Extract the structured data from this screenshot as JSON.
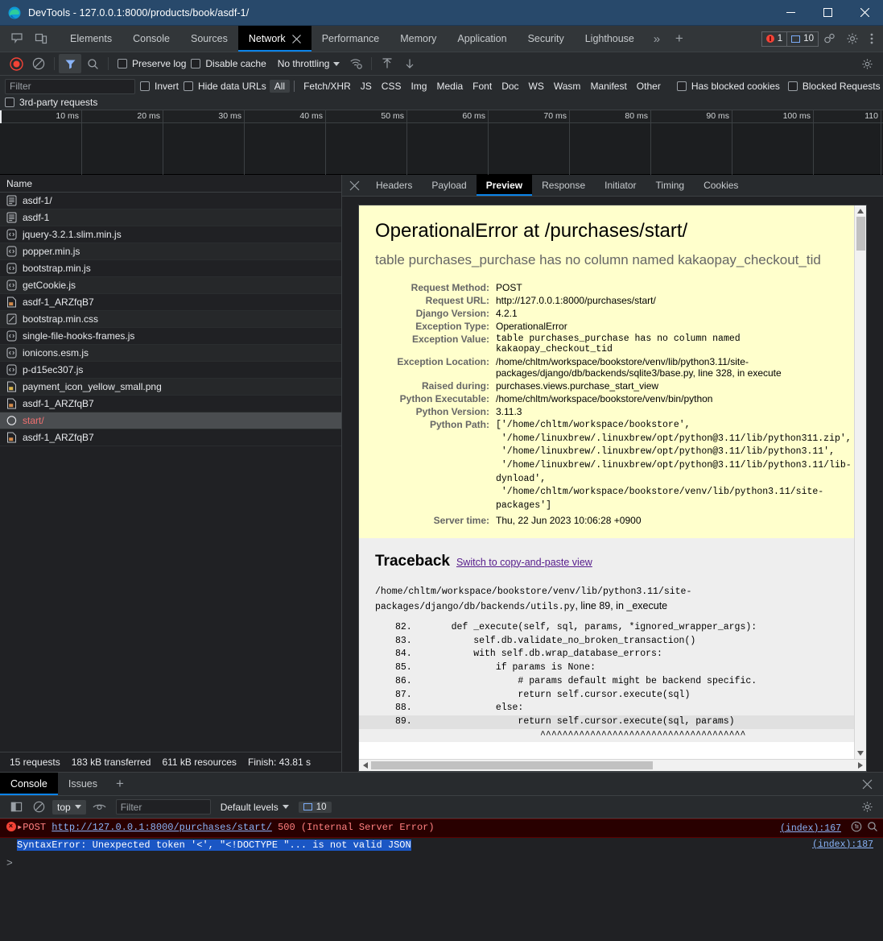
{
  "window": {
    "title": "DevTools - 127.0.0.1:8000/products/book/asdf-1/",
    "minimize": "minimize-icon",
    "maximize": "maximize-icon",
    "close": "close-icon"
  },
  "main_tabs": {
    "items": [
      {
        "label": "Elements",
        "active": false
      },
      {
        "label": "Console",
        "active": false
      },
      {
        "label": "Sources",
        "active": false
      },
      {
        "label": "Network",
        "active": true,
        "closable": true
      },
      {
        "label": "Performance",
        "active": false
      },
      {
        "label": "Memory",
        "active": false
      },
      {
        "label": "Application",
        "active": false
      },
      {
        "label": "Security",
        "active": false
      },
      {
        "label": "Lighthouse",
        "active": false
      }
    ],
    "more": "»",
    "add": "+",
    "error_count": "1",
    "message_count": "10"
  },
  "network_toolbar": {
    "record_label": "record-button",
    "clear_label": "clear-button",
    "filter_label": "filter-button",
    "search_label": "search-button",
    "preserve_log": "Preserve log",
    "disable_cache": "Disable cache",
    "throttling": "No throttling",
    "import_label": "import-har-button",
    "export_label": "export-har-button",
    "settings_label": "settings-gear"
  },
  "filter_bar": {
    "placeholder": "Filter",
    "value": "",
    "invert": "Invert",
    "hide_data_urls": "Hide data URLs",
    "types": [
      "All",
      "Fetch/XHR",
      "JS",
      "CSS",
      "Img",
      "Media",
      "Font",
      "Doc",
      "WS",
      "Wasm",
      "Manifest",
      "Other"
    ],
    "active_type": "All",
    "has_blocked_cookies": "Has blocked cookies",
    "blocked_requests": "Blocked Requests",
    "third_party": "3rd-party requests"
  },
  "overview": {
    "ticks": [
      "10 ms",
      "20 ms",
      "30 ms",
      "40 ms",
      "50 ms",
      "60 ms",
      "70 ms",
      "80 ms",
      "90 ms",
      "100 ms",
      "110"
    ]
  },
  "requests": {
    "column_header": "Name",
    "rows": [
      {
        "name": "asdf-1/",
        "icon": "document-icon",
        "selected": false
      },
      {
        "name": "asdf-1",
        "icon": "document-icon",
        "selected": false
      },
      {
        "name": "jquery-3.2.1.slim.min.js",
        "icon": "script-icon",
        "selected": false
      },
      {
        "name": "popper.min.js",
        "icon": "script-icon",
        "selected": false
      },
      {
        "name": "bootstrap.min.js",
        "icon": "script-icon",
        "selected": false
      },
      {
        "name": "getCookie.js",
        "icon": "script-icon",
        "selected": false
      },
      {
        "name": "asdf-1_ARZfqB7",
        "icon": "image-icon",
        "selected": false
      },
      {
        "name": "bootstrap.min.css",
        "icon": "stylesheet-icon",
        "selected": false
      },
      {
        "name": "single-file-hooks-frames.js",
        "icon": "script-icon",
        "selected": false
      },
      {
        "name": "ionicons.esm.js",
        "icon": "script-icon",
        "selected": false
      },
      {
        "name": "p-d15ec307.js",
        "icon": "script-icon",
        "selected": false
      },
      {
        "name": "payment_icon_yellow_small.png",
        "icon": "image-icon",
        "selected": false
      },
      {
        "name": "asdf-1_ARZfqB7",
        "icon": "image-icon",
        "selected": false
      },
      {
        "name": "start/",
        "icon": "fetch-icon",
        "selected": true
      },
      {
        "name": "asdf-1_ARZfqB7",
        "icon": "image-icon",
        "selected": false
      }
    ],
    "status": {
      "requests": "15 requests",
      "transferred": "183 kB transferred",
      "resources": "611 kB resources",
      "finish": "Finish: 43.81 s"
    }
  },
  "detail_tabs": {
    "close": "close-icon",
    "items": [
      {
        "label": "Headers",
        "active": false
      },
      {
        "label": "Payload",
        "active": false
      },
      {
        "label": "Preview",
        "active": true
      },
      {
        "label": "Response",
        "active": false
      },
      {
        "label": "Initiator",
        "active": false
      },
      {
        "label": "Timing",
        "active": false
      },
      {
        "label": "Cookies",
        "active": false
      }
    ]
  },
  "django_error": {
    "heading": "OperationalError at /purchases/start/",
    "subheading": "table purchases_purchase has no column named kakaopay_checkout_tid",
    "meta": [
      {
        "label": "Request Method:",
        "value": "POST",
        "mono": false
      },
      {
        "label": "Request URL:",
        "value": "http://127.0.0.1:8000/purchases/start/",
        "mono": false
      },
      {
        "label": "Django Version:",
        "value": "4.2.1",
        "mono": false
      },
      {
        "label": "Exception Type:",
        "value": "OperationalError",
        "mono": false
      },
      {
        "label": "Exception Value:",
        "value": "table purchases_purchase has no column named kakaopay_checkout_tid",
        "mono": true
      },
      {
        "label": "Exception Location:",
        "value": "/home/chltm/workspace/bookstore/venv/lib/python3.11/site-packages/django/db/backends/sqlite3/base.py, line 328, in execute",
        "mono": false
      },
      {
        "label": "Raised during:",
        "value": "purchases.views.purchase_start_view",
        "mono": false
      },
      {
        "label": "Python Executable:",
        "value": "/home/chltm/workspace/bookstore/venv/bin/python",
        "mono": false
      },
      {
        "label": "Python Version:",
        "value": "3.11.3",
        "mono": false
      },
      {
        "label": "Python Path:",
        "value": "['/home/chltm/workspace/bookstore',\n '/home/linuxbrew/.linuxbrew/opt/python@3.11/lib/python311.zip',\n '/home/linuxbrew/.linuxbrew/opt/python@3.11/lib/python3.11',\n '/home/linuxbrew/.linuxbrew/opt/python@3.11/lib/python3.11/lib-\ndynload',\n '/home/chltm/workspace/bookstore/venv/lib/python3.11/site-packages']",
        "mono": true
      },
      {
        "label": "Server time:",
        "value": "Thu, 22 Jun 2023 10:06:28 +0900",
        "mono": false
      }
    ],
    "traceback": {
      "title": "Traceback",
      "switch_link": "Switch to copy-and-paste view",
      "file_path": "/home/chltm/workspace/bookstore/venv/lib/python3.11/site-packages/django/db/backends/utils.py",
      "file_suffix": ", line 89, in _execute",
      "code": [
        {
          "num": "82.",
          "text": "    def _execute(self, sql, params, *ignored_wrapper_args):",
          "highlight": false
        },
        {
          "num": "83.",
          "text": "        self.db.validate_no_broken_transaction()",
          "highlight": false
        },
        {
          "num": "84.",
          "text": "        with self.db.wrap_database_errors:",
          "highlight": false
        },
        {
          "num": "85.",
          "text": "            if params is None:",
          "highlight": false
        },
        {
          "num": "86.",
          "text": "                # params default might be backend specific.",
          "highlight": false
        },
        {
          "num": "87.",
          "text": "                return self.cursor.execute(sql)",
          "highlight": false
        },
        {
          "num": "88.",
          "text": "            else:",
          "highlight": false
        },
        {
          "num": "89.",
          "text": "                return self.cursor.execute(sql, params)",
          "highlight": true
        },
        {
          "num": "",
          "text": "                    ^^^^^^^^^^^^^^^^^^^^^^^^^^^^^^^^^^^^^",
          "highlight": false
        }
      ]
    }
  },
  "drawer": {
    "tabs": [
      {
        "label": "Console",
        "active": true
      },
      {
        "label": "Issues",
        "active": false
      }
    ],
    "add": "+",
    "close": "close-icon",
    "toolbar": {
      "sidebar_label": "show-console-sidebar",
      "clear_label": "clear-console",
      "context": "top",
      "eye_label": "live-expressions",
      "filter_placeholder": "Filter",
      "filter_value": "",
      "levels": "Default levels",
      "message_count": "10",
      "settings_label": "console-settings"
    },
    "messages": [
      {
        "type": "error",
        "expander": "▸",
        "method": "POST",
        "url": "http://127.0.0.1:8000/purchases/start/",
        "status": "500 (Internal Server Error)",
        "source": "(index):167"
      },
      {
        "type": "selected-text",
        "text": "SyntaxError: Unexpected token '<', \"<!DOCTYPE \"... is not valid JSON",
        "source": "(index):187"
      }
    ],
    "prompt": ">"
  },
  "colors": {
    "accent": "#0b83e8",
    "error": "#f44336",
    "link": "#8ab4f8",
    "django_bg": "#ffffcc",
    "traceback_bg": "#eeeeee",
    "titlebar": "#28496b"
  }
}
